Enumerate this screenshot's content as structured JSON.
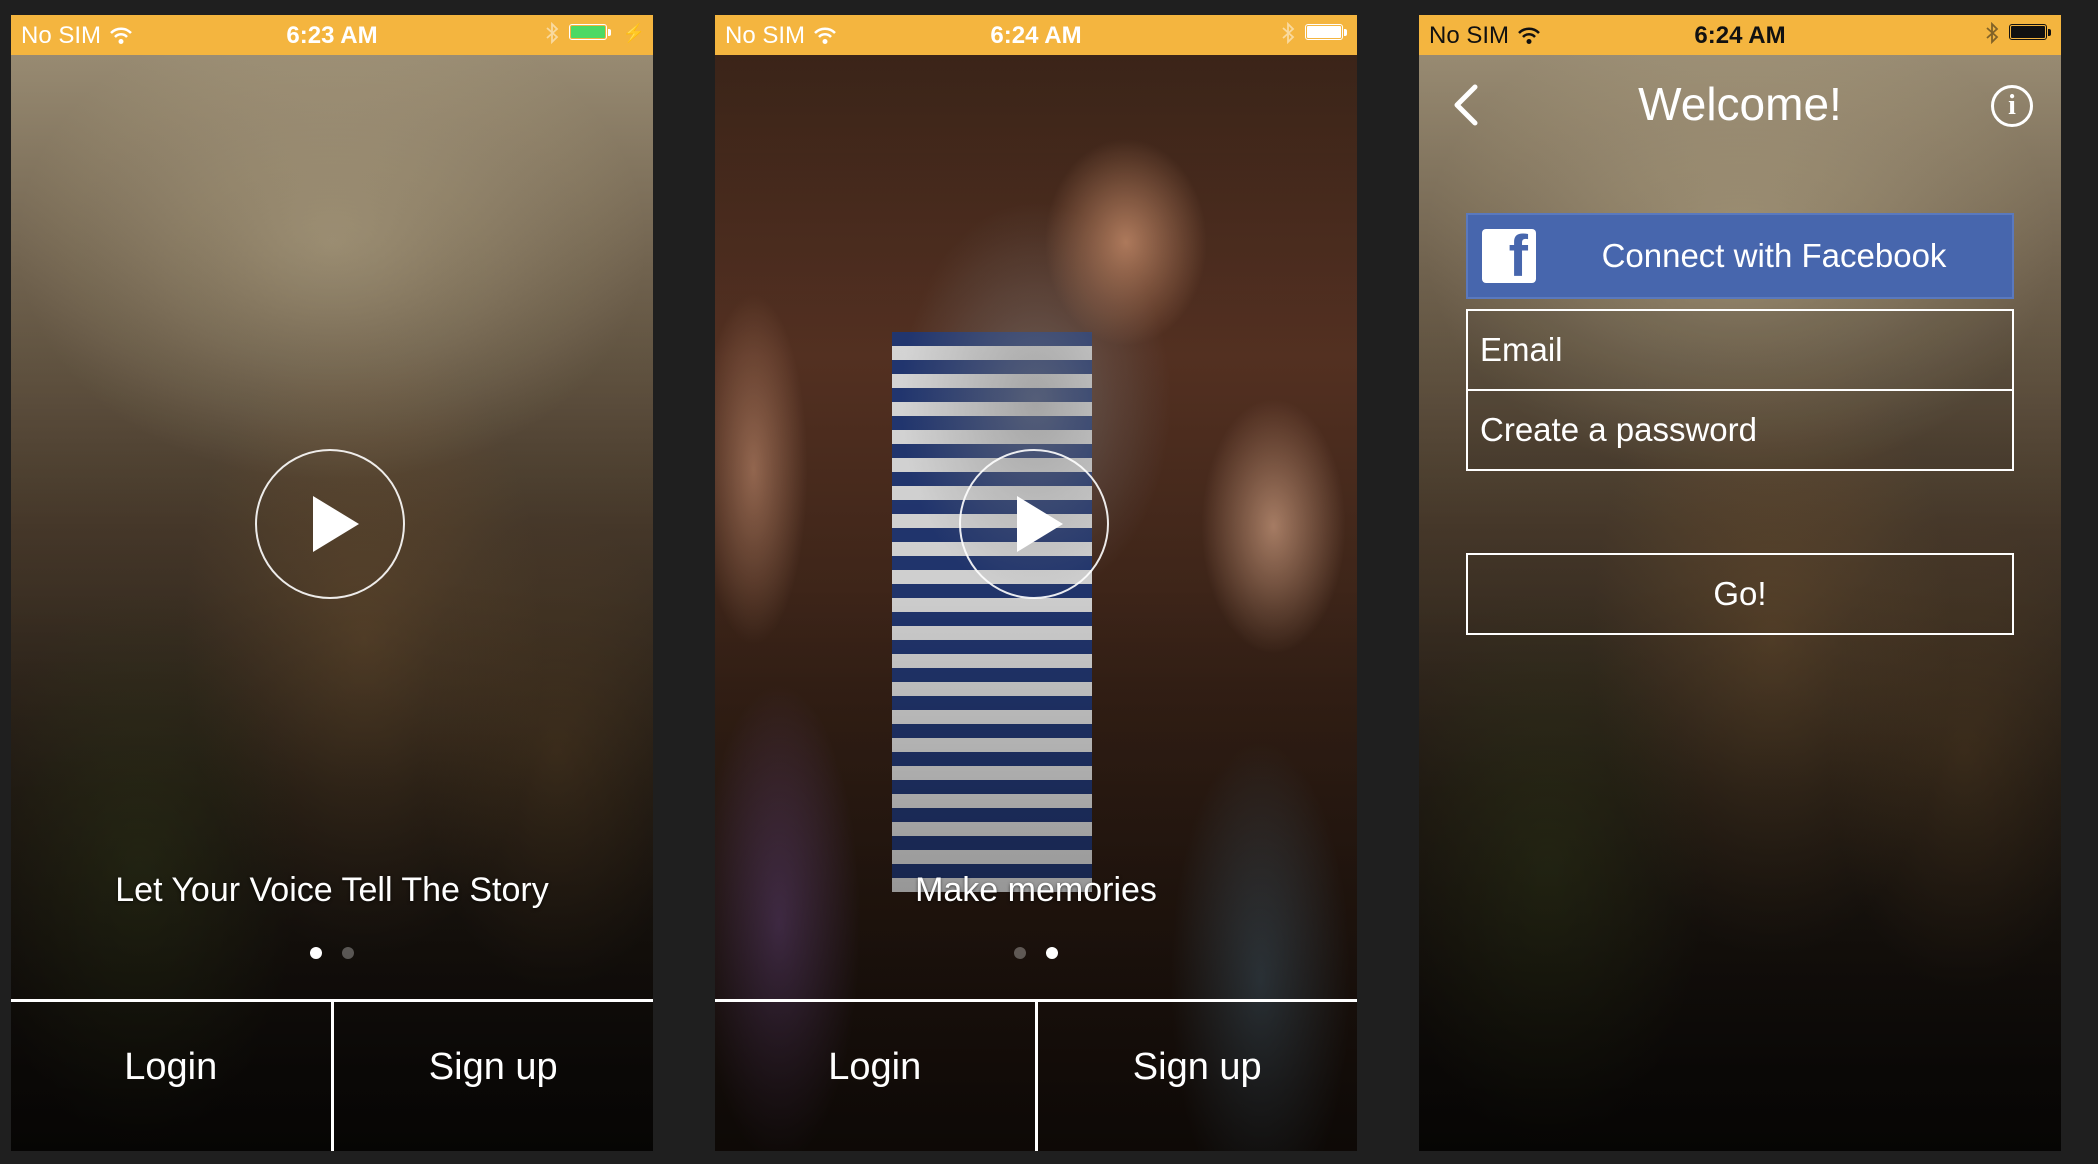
{
  "colors": {
    "status_bar": "#f4b53f",
    "facebook_blue": "#4766ad",
    "page_background": "#1f1f1f"
  },
  "screens": [
    {
      "status": {
        "carrier": "No SIM",
        "time": "6:23 AM",
        "battery_charging": true
      },
      "caption": "Let Your Voice Tell The Story",
      "page_index": 0,
      "page_count": 2,
      "login_label": "Login",
      "signup_label": "Sign up"
    },
    {
      "status": {
        "carrier": "No SIM",
        "time": "6:24 AM",
        "battery_charging": false
      },
      "caption": "Make memories",
      "page_index": 1,
      "page_count": 2,
      "login_label": "Login",
      "signup_label": "Sign up"
    },
    {
      "status": {
        "carrier": "No SIM",
        "time": "6:24 AM",
        "battery_charging": false
      },
      "title": "Welcome!",
      "facebook_label": "Connect with Facebook",
      "email_placeholder": "Email",
      "password_placeholder": "Create a password",
      "go_label": "Go!"
    }
  ],
  "icons": {
    "status": [
      "wifi-icon",
      "bluetooth-icon",
      "battery-icon",
      "charging-icon"
    ],
    "play": "play-icon",
    "back": "back-chevron-icon",
    "info": "info-icon",
    "facebook": "facebook-logo-icon"
  }
}
